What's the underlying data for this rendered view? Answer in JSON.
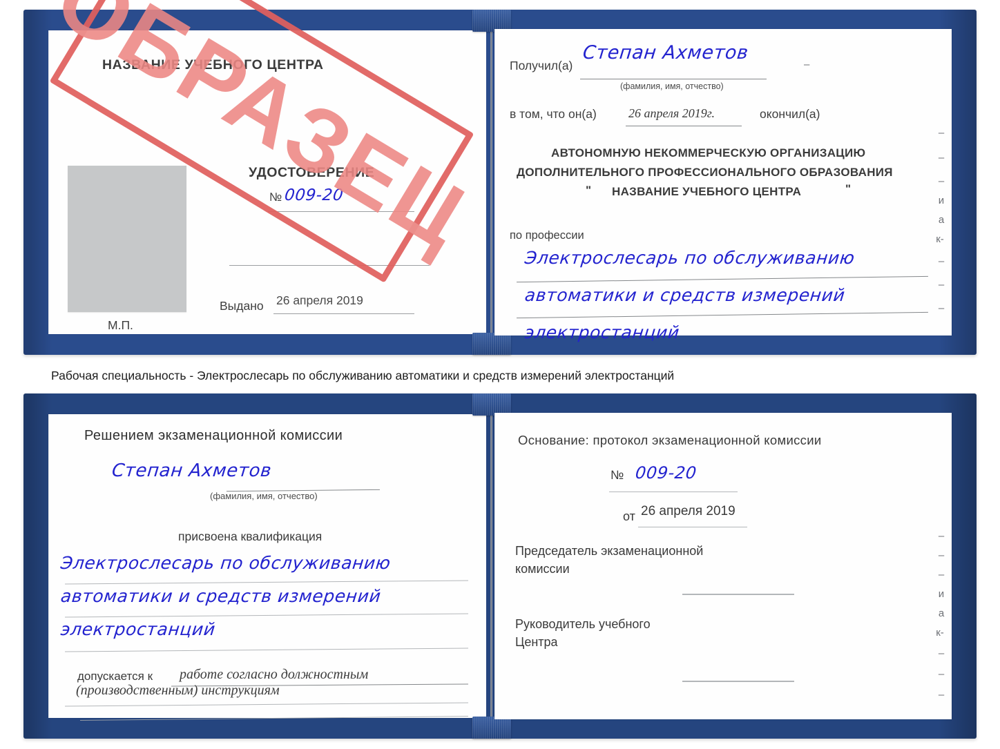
{
  "document": {
    "kind": "udostoverenie-sample-scan",
    "sample_stamp": "ОБРАЗЕЦ",
    "accent_blue_cover": "#2a4c8d",
    "accent_red_stamp": "#e0605e",
    "handwriting_ink": "#2323cf",
    "photo_placeholder_color": "#c6c8c9"
  },
  "caption": {
    "text": "Рабочая специальность - Электрослесарь по обслуживанию автоматики и средств измерений электростанций"
  },
  "cert1": {
    "left_page": {
      "org_title": "НАЗВАНИЕ УЧЕБНОГО ЦЕНТРА",
      "doc_title": "УДОСТОВЕРЕНИЕ",
      "number_label": "№",
      "number_value": "009-20",
      "issued_label": "Выдано",
      "issued_value": "26 апреля 2019",
      "seal_label": "М.П."
    },
    "right_page": {
      "received_label": "Получил(а)",
      "received_value": "Степан Ахметов",
      "fio_hint": "(фамилия, имя, отчество)",
      "in_that_label": "в том, что он(а)",
      "in_that_value": "26 апреля 2019г.",
      "finished_label": "окончил(а)",
      "org_line1": "АВТОНОМНУЮ НЕКОММЕРЧЕСКУЮ ОРГАНИЗАЦИЮ",
      "org_line2": "ДОПОЛНИТЕЛЬНОГО ПРОФЕССИОНАЛЬНОГО ОБРАЗОВАНИЯ",
      "org_quote_open": "\"",
      "org_line3": "НАЗВАНИЕ УЧЕБНОГО ЦЕНТРА",
      "org_quote_close": "\"",
      "profession_label": "по профессии",
      "profession_line1": "Электрослесарь по обслуживанию",
      "profession_line2": "автоматики и средств измерений",
      "profession_line3": "электростанций"
    },
    "edge_fragments": [
      "–",
      "–",
      "–",
      "и",
      "а",
      "к-",
      "–",
      "–",
      "–"
    ]
  },
  "cert2": {
    "left_page": {
      "decision_title": "Решением экзаменационной комиссии",
      "name_value": "Степан Ахметов",
      "fio_hint": "(фамилия, имя, отчество)",
      "qualification_label": "присвоена квалификация",
      "qualification_line1": "Электрослесарь по обслуживанию",
      "qualification_line2": "автоматики и средств измерений",
      "qualification_line3": "электростанций",
      "allowed_label": "допускается к",
      "allowed_value_line1": "работе согласно должностным",
      "allowed_value_line2": "(производственным) инструкциям"
    },
    "right_page": {
      "basis_label": "Основание: протокол экзаменационной комиссии",
      "number_label": "№",
      "number_value": "009-20",
      "date_label": "от",
      "date_value": "26 апреля 2019",
      "chairman_line1": "Председатель экзаменационной",
      "chairman_line2": "комиссии",
      "head_line1": "Руководитель учебного",
      "head_line2": "Центра"
    },
    "edge_fragments": [
      "–",
      "–",
      "–",
      "и",
      "а",
      "к-",
      "–",
      "–",
      "–"
    ]
  }
}
